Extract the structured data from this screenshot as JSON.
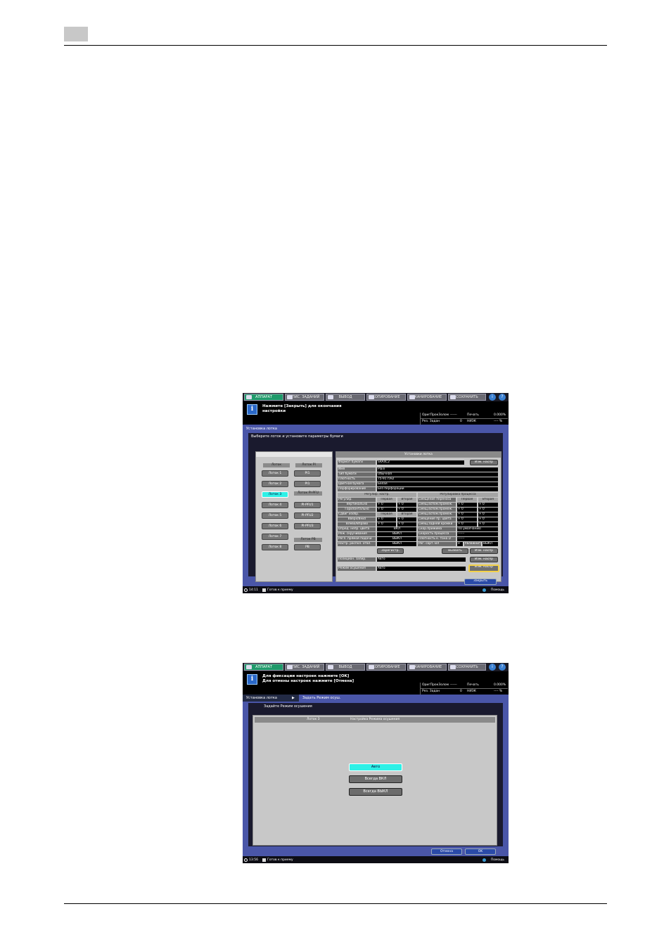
{
  "screen1": {
    "tabs": [
      "АППАРАТ",
      "СПИС. ЗАДАНИЙ",
      "ВЫВОД",
      "КОПИРОВАНИЕ",
      "СКАНИРОВАНИЕ",
      "СОХРАНИТЬ"
    ],
    "message": [
      "Нажмите [Закрыть] для окончания",
      "настройки"
    ],
    "counters": {
      "row1": {
        "l1": "ОригПрокЗолом",
        "v1": "------",
        "l2": "Печать",
        "v2": "0.000%"
      },
      "row2": {
        "l1": "Рез. Задан",
        "v1": "0",
        "l2": "НИЗК",
        "v2": "---- %"
      }
    },
    "frame_title": "Установка лотка",
    "instruction": "Выберите лоток и установите параметры бумаги",
    "tray_headers": {
      "trays": "Лоток",
      "pi": "Лоток PI",
      "pi_pfu": "Лоток PI-PFU",
      "pb": "Лоток PB"
    },
    "trays": [
      "Лоток 1",
      "Лоток 2",
      "Лоток 3",
      "Лоток 4",
      "Лоток 5",
      "Лоток 6",
      "Лоток 7",
      "Лоток 8"
    ],
    "pi_trays": [
      "PI1",
      "PI1"
    ],
    "pfu_trays": [
      "PI-PFU1",
      "PI-PFU2",
      "PI-PFU3"
    ],
    "pb_trays": [
      "PB"
    ],
    "panel_title": "Установки лотка",
    "paper_size_label": "Формат бумаги",
    "paper_size_value": "SRA4C2",
    "change_label": "Изм. наспр",
    "fields": [
      {
        "label": "Имя",
        "value": "Plain"
      },
      {
        "label": "Тип бумаги",
        "value": "Обычная"
      },
      {
        "label": "Плотность",
        "value": "75-91 г/м2"
      },
      {
        "label": "Цветная бумага",
        "value": "Белая"
      },
      {
        "label": "Перфорирование",
        "value": "Без перфорации"
      }
    ],
    "left_table": {
      "head": "Регулир. настр.",
      "sub1": {
        "label": "Регулир.",
        "c1": "Первая",
        "c2": "Вторая"
      },
      "rows1": [
        {
          "label": "Вертикально",
          "c1": "+ 0",
          "c2": "+ 0"
        },
        {
          "label": "Горизонтально",
          "c1": "+ 0",
          "c2": "+ 0"
        }
      ],
      "sub2": {
        "label": "Сдвиг изобр.",
        "c1": "Первая",
        "c2": "Вторая"
      },
      "rows2": [
        {
          "label": "Вверх/Вниз",
          "c1": "+ 0",
          "c2": "+ 0"
        },
        {
          "label": "Влево/Вправо",
          "c1": "+ 0",
          "c2": "+ 0"
        }
      ],
      "rows3": [
        {
          "label": "Опред. непр. цвета",
          "value": "ВКЛ"
        },
        {
          "label": "Реж. скручивания",
          "value": "ВЫКЛ"
        },
        {
          "label": "Регл. прямой подачи",
          "value": "ВЫКЛ"
        },
        {
          "label": "Настр. распол. отвл.",
          "value": "ВЫКЛ"
        }
      ]
    },
    "right_table": {
      "head": "Регулировка процесса",
      "sub1": {
        "label": "Смещение переноса",
        "c1": "Первая",
        "c2": "Вторая"
      },
      "rows1": [
        {
          "label": "Смещ.вспом.промеж.",
          "c1": "+ 0",
          "c2": "+ 0"
        },
        {
          "label": "Смещ.вспом.промеж.",
          "c1": "+ 0",
          "c2": "+ 0"
        },
        {
          "label": "Смещ.вспом.промеж.",
          "c1": "+ 0",
          "c2": "+ 0"
        },
        {
          "label": "Смещение пр. цвета",
          "c1": "+ 0",
          "c2": "+ 0"
        },
        {
          "label": "Смещ.задней кромки",
          "c1": "+ 0",
          "c2": "+ 0"
        }
      ],
      "rows2": [
        {
          "label": "Скор.прижима",
          "value": "По умолчанию"
        },
        {
          "label": "Скорость процесса",
          "value": "------"
        },
        {
          "label": "Плотность к. тона D",
          "value": "------"
        },
        {
          "label": "Рег. сорт. ВЛ",
          "value": "0",
          "label2": "Увлажнит.",
          "value2": "ВЫКЛ"
        }
      ]
    },
    "register_btn": "Зарегистр.",
    "recall_btn": "Вызвать",
    "other_rows": [
      {
        "label": "Позицион. запир.",
        "value": "Авто"
      },
      {
        "label": "Режим осушения",
        "value": "Авто"
      }
    ],
    "close_btn": "Закрыть",
    "status": {
      "time": "14:11",
      "text": "Готов к приему",
      "help": "Помощь"
    }
  },
  "screen2": {
    "tabs": [
      "АППАРАТ",
      "СПИС. ЗАДАНИЙ",
      "ВЫВОД",
      "КОПИРОВАНИЕ",
      "СКАНИРОВАНИЕ",
      "СОХРАНИТЬ"
    ],
    "message": [
      "Для фиксации настроек нажмите [OK]",
      "Для отмены настроек нажмите [Отмена]"
    ],
    "counters": {
      "row1": {
        "l1": "ОригПрокЗолом",
        "v1": "------",
        "l2": "Печать",
        "v2": "0.000%"
      },
      "row2": {
        "l1": "Рез. Задан",
        "v1": "0",
        "l2": "НИЗК",
        "v2": "---- %"
      }
    },
    "crumb1": "Установка лотка",
    "crumb2": "Задать Режим осуш.",
    "instruction": "Задайте Режим осушения",
    "head_tray": "Лоток 3",
    "head_title": "Настройка Режима осушения",
    "options": [
      "Авто",
      "Всегда ВКЛ",
      "Всегда ВЫКЛ"
    ],
    "cancel_btn": "Отмена",
    "ok_btn": "OK",
    "status": {
      "time": "13:56",
      "text": "Готов к приему",
      "help": "Помощь"
    }
  }
}
